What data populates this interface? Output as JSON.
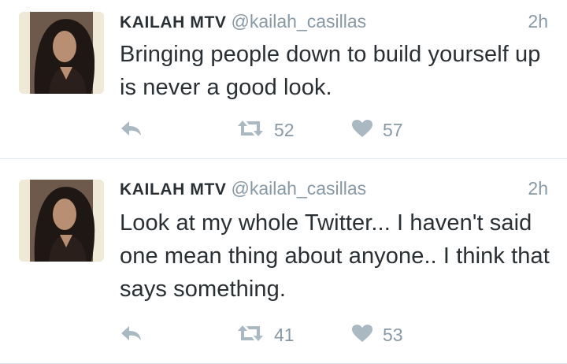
{
  "tweets": [
    {
      "name": "KAILAH MTV",
      "handle": "@kailah_casillas",
      "time": "2h",
      "text": "Bringing people down to build yourself up is never a good look.",
      "retweets": "52",
      "likes": "57"
    },
    {
      "name": "KAILAH MTV",
      "handle": "@kailah_casillas",
      "time": "2h",
      "text": "Look at my whole Twitter... I haven't said one mean thing about anyone.. I think that says something.",
      "retweets": "41",
      "likes": "53"
    }
  ],
  "icons": {
    "reply": "reply-icon",
    "retweet": "retweet-icon",
    "like": "heart-icon"
  },
  "colors": {
    "text": "#292f33",
    "muted": "#8899a6",
    "icon": "#aab8c2",
    "divider": "#e1e8ed"
  }
}
